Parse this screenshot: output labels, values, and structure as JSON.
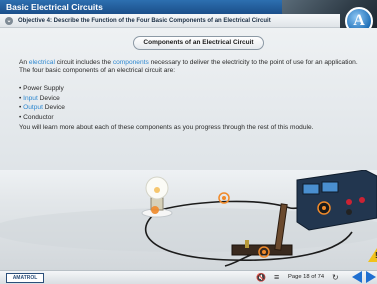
{
  "app": {
    "title": "Basic Electrical Circuits",
    "logo_letter": "A"
  },
  "objective": {
    "text": "Objective 4: Describe the Function of the Four Basic Components of an Electrical Circuit"
  },
  "section": {
    "heading": "Components of an Electrical Circuit"
  },
  "intro": {
    "part1": "An ",
    "link1": "electrical",
    "part2": " circuit includes the ",
    "link2": "components",
    "part3": " necessary to deliver the electricity to the point of use for an application. The four basic components of an electrical circuit are:"
  },
  "components_list": [
    {
      "pre": "",
      "link": "",
      "post": "Power Supply"
    },
    {
      "pre": "",
      "link": "Input",
      "post": " Device"
    },
    {
      "pre": "",
      "link": "Output",
      "post": " Device"
    },
    {
      "pre": "",
      "link": "",
      "post": "Conductor"
    }
  ],
  "outro": "You will learn more about each of these components as you progress through the rest of this module.",
  "footer": {
    "brand": "AMATROL",
    "page_label": "Page 18 of 74",
    "mute_icon": "speaker-mute-icon",
    "menu_icon": "menu-icon",
    "reload_icon": "reload-icon"
  },
  "colors": {
    "title_blue": "#1b4f8a",
    "link_blue": "#2e88d0",
    "nav_blue": "#1f6fd0",
    "warning": "#f2c21a"
  }
}
